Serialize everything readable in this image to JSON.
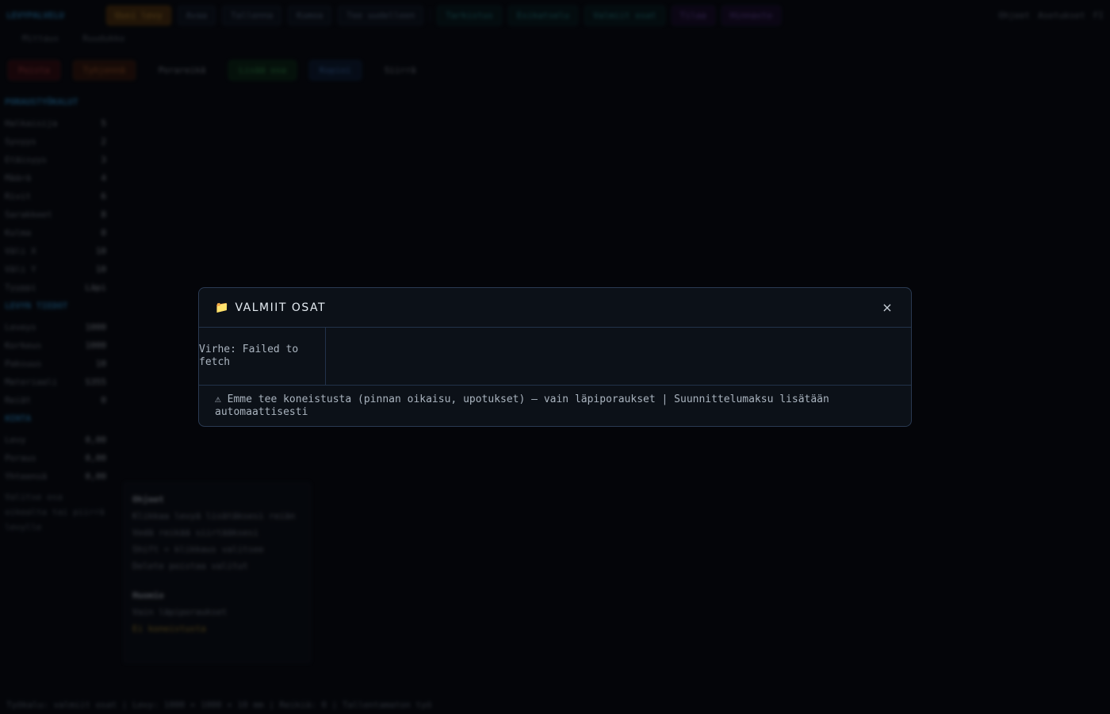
{
  "app": {
    "logo": "LEVYPALVELU",
    "top_buttons": [
      {
        "label": "Uusi levy",
        "style": "orange"
      },
      {
        "label": "Avaa",
        "style": "plain"
      },
      {
        "label": "Tallenna",
        "style": "plain"
      },
      {
        "label": "Kumoa",
        "style": "plain"
      },
      {
        "label": "Tee uudelleen",
        "style": "plain"
      },
      {
        "label": "Tarkistus",
        "style": "teal"
      },
      {
        "label": "Esikatselu",
        "style": "teal"
      },
      {
        "label": "Valmiit osat",
        "style": "teal"
      },
      {
        "label": "Tilaa",
        "style": "purple"
      },
      {
        "label": "Hinnasto",
        "style": "purple"
      }
    ],
    "top_right": [
      "Ohjeet",
      "Asetukset",
      "FI"
    ],
    "subtools": [
      "Mittaus",
      "Ruudukko"
    ],
    "tool_buttons": [
      {
        "label": "Poista",
        "style": "red"
      },
      {
        "label": "Tyhjennä",
        "style": "ored"
      },
      {
        "label": "Porareikä",
        "style": "plain"
      },
      {
        "label": "Lisää osa",
        "style": "green"
      },
      {
        "label": "Kopioi",
        "style": "blue"
      },
      {
        "label": "Siirrä",
        "style": "plain"
      }
    ],
    "sidebar": {
      "title": "PORAUSTYÖKALUT",
      "rows": [
        {
          "label": "Halkaisija",
          "value": "5"
        },
        {
          "label": "Syvyys",
          "value": "2"
        },
        {
          "label": "Etäisyys",
          "value": "3"
        },
        {
          "label": "Määrä",
          "value": "4"
        },
        {
          "label": "Rivit",
          "value": "6"
        },
        {
          "label": "Sarakkeet",
          "value": "8"
        },
        {
          "label": "Kulma",
          "value": "0"
        },
        {
          "label": "Väli X",
          "value": "10"
        },
        {
          "label": "Väli Y",
          "value": "10"
        },
        {
          "label": "Tyyppi",
          "value": "Läpi"
        }
      ],
      "title2": "LEVYN TIEDOT",
      "rows2": [
        {
          "label": "Leveys",
          "value": "1000"
        },
        {
          "label": "Korkeus",
          "value": "1000"
        },
        {
          "label": "Paksuus",
          "value": "10"
        },
        {
          "label": "Materiaali",
          "value": "S355"
        },
        {
          "label": "Reiät",
          "value": "0"
        }
      ],
      "title3": "HINTA",
      "rows3": [
        {
          "label": "Levy",
          "value": "0,00"
        },
        {
          "label": "Poraus",
          "value": "0,00"
        },
        {
          "label": "Yhteensä",
          "value": "0,00"
        }
      ],
      "note": "Valitse osa oikealta tai piirrä levylle"
    },
    "infobox": {
      "h1": "Ohjeet",
      "lines1": [
        "Klikkaa levyä lisätäksesi reiän",
        "Vedä reikää siirtääksesi",
        "Shift + klikkaus valitsee",
        "Delete poistaa valitut"
      ],
      "h2": "Huomio",
      "lines2": [
        "Vain läpiporaukset"
      ],
      "warn": "Ei koneistusta"
    },
    "statusbar": "Työkalu: valmiit osat  |  Levy: 1000 × 1000 × 10 mm  |  Reikiä: 0  |  Tallentamaton työ"
  },
  "modal": {
    "folder_icon": "📁",
    "title": "VALMIIT OSAT",
    "close": "×",
    "error": "Virhe: Failed to fetch",
    "footer": "⚠ Emme tee koneistusta (pinnan oikaisu, upotukset) – vain läpiporaukset  |  Suunnittelumaksu lisätään automaattisesti"
  }
}
